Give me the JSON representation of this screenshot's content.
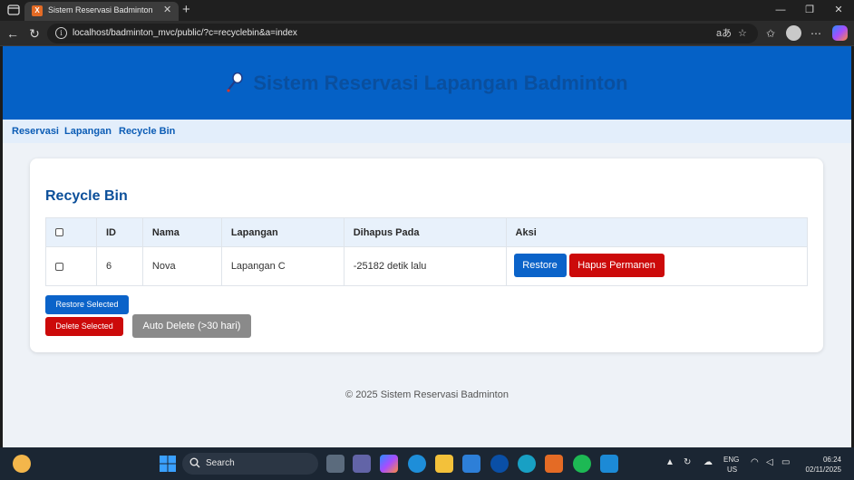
{
  "browser": {
    "tab_title": "Sistem Reservasi Badminton",
    "tab_close": "✕",
    "new_tab": "+",
    "url": "localhost/badminton_mvc/public/?c=recyclebin&a=index",
    "read_aloud": "aあ"
  },
  "site": {
    "title": "Sistem Reservasi Lapangan Badminton",
    "nav": [
      "Reservasi",
      "Lapangan",
      "Recycle Bin"
    ]
  },
  "recycle_bin": {
    "title": "Recycle Bin",
    "columns": [
      "ID",
      "Nama",
      "Lapangan",
      "Dihapus Pada",
      "Aksi"
    ],
    "rows": [
      {
        "id": "6",
        "nama": "Nova",
        "lapangan": "Lapangan C",
        "dihapus_pada": "-25182 detik lalu"
      }
    ],
    "restore_label": "Restore",
    "hapus_label": "Hapus Permanen",
    "restore_selected": "Restore Selected",
    "delete_selected": "Delete Selected",
    "auto_delete": "Auto Delete (>30 hari)"
  },
  "footer": "© 2025 Sistem Reservasi Badminton",
  "taskbar": {
    "search_label": "Search",
    "language": "ENG",
    "region": "US",
    "time": "06:24",
    "date": "02/11/2025"
  },
  "colors": {
    "header_blue": "#0561c6",
    "restore_blue": "#0b63c9",
    "delete_red": "#cc0a0a",
    "auto_gray": "#8a8a8a"
  }
}
